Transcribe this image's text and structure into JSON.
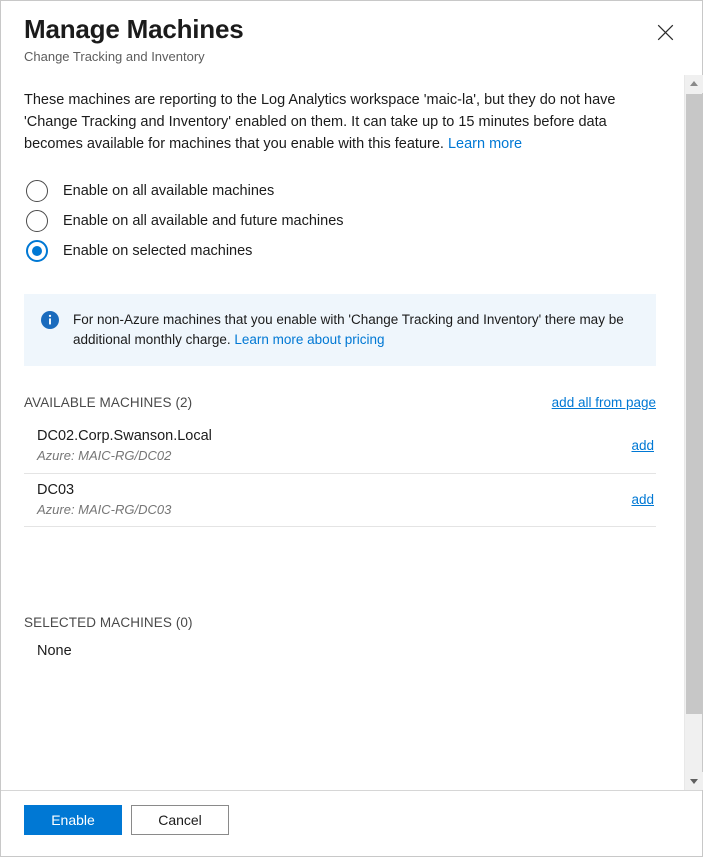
{
  "dialog": {
    "title": "Manage Machines",
    "subtitle": "Change Tracking and Inventory",
    "close_label": "close-icon"
  },
  "description": {
    "text": "These machines are reporting to the Log Analytics workspace 'maic-la', but they do not have 'Change Tracking and Inventory' enabled on them. It can take up to 15 minutes before data becomes available for machines that you enable with this feature.",
    "link_label": "Learn more"
  },
  "options": [
    {
      "label": "Enable on all available machines",
      "selected": false
    },
    {
      "label": "Enable on all available and future machines",
      "selected": false
    },
    {
      "label": "Enable on selected machines",
      "selected": true
    }
  ],
  "info_banner": {
    "icon": "info-icon",
    "text": "For non-Azure machines that you enable with 'Change Tracking and Inventory' there may be additional monthly charge.",
    "link_label": "Learn more about pricing"
  },
  "available": {
    "heading": "AVAILABLE MACHINES (2)",
    "add_all_label": "add all from page",
    "machines": [
      {
        "name": "DC02.Corp.Swanson.Local",
        "detail": "Azure: MAIC-RG/DC02",
        "action": "add"
      },
      {
        "name": "DC03",
        "detail": "Azure: MAIC-RG/DC03",
        "action": "add"
      }
    ]
  },
  "selected": {
    "heading": "SELECTED MACHINES (0)",
    "empty_label": "None"
  },
  "footer": {
    "primary_label": "Enable",
    "secondary_label": "Cancel"
  },
  "colors": {
    "accent": "#0078d4",
    "link": "#0078d4",
    "info_bg": "#eff6fc",
    "text": "#1b1b1b",
    "muted": "#767676"
  }
}
